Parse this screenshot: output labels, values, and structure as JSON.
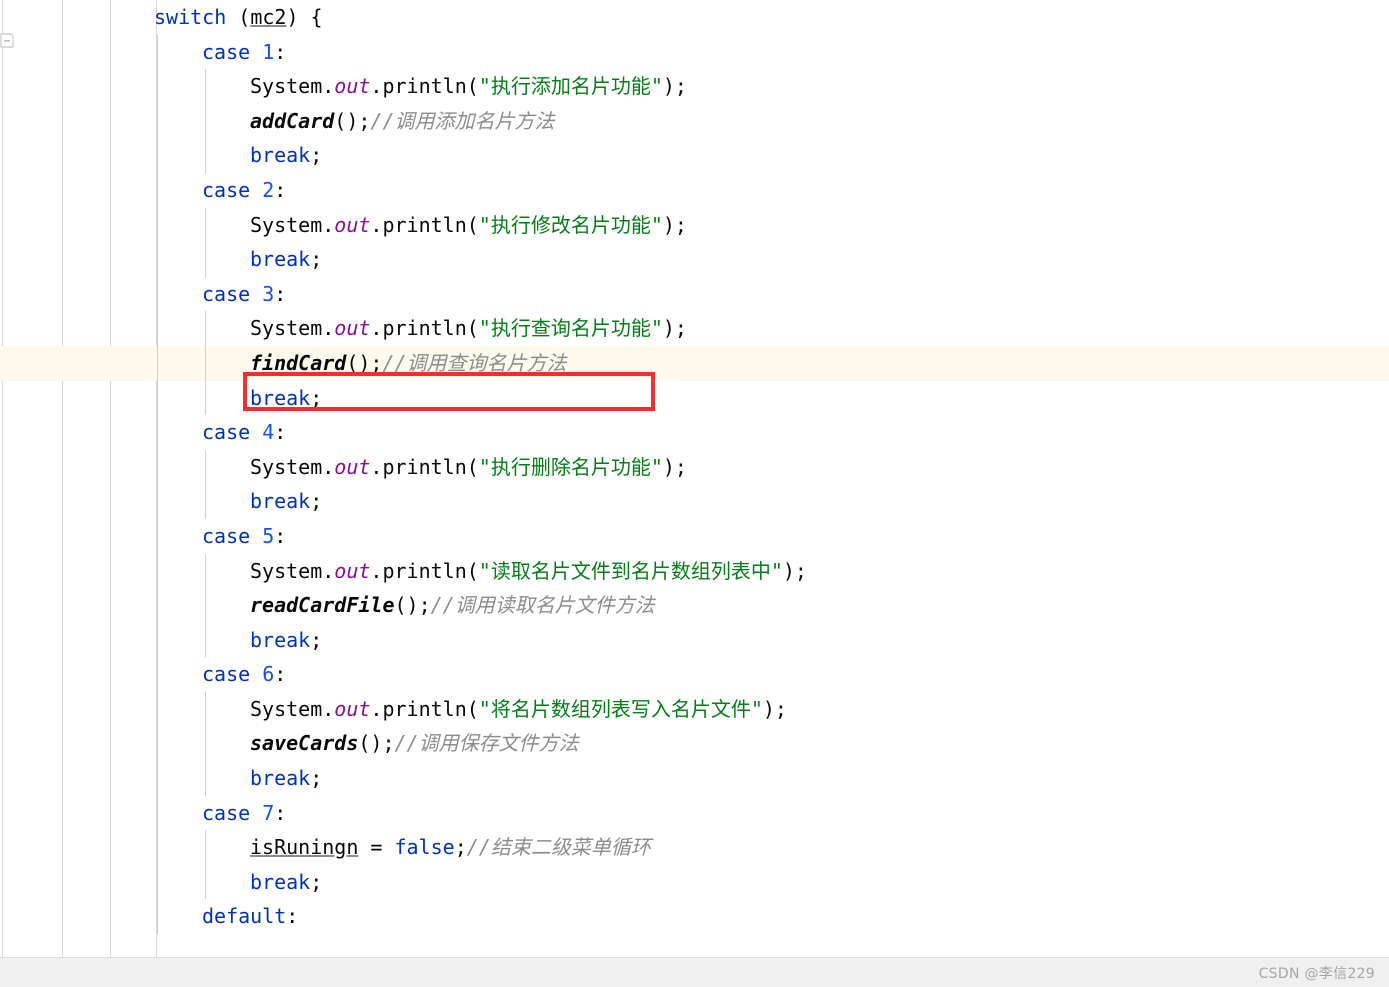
{
  "editor": {
    "gutter": {
      "fold_marker": "fold-collapse-marker"
    },
    "highlight_color": "#fdf9ec",
    "annotation": {
      "type": "red-rectangle",
      "color": "#f03030",
      "targets_line": 12,
      "target_text": "findCard();//调用查询名片方法"
    },
    "colors": {
      "keyword": "#0033b3",
      "number": "#1750eb",
      "string": "#067d17",
      "static_field": "#871094",
      "comment": "#8c8c8c",
      "plain": "#080808",
      "guide": "#d0d0d0"
    },
    "lines": [
      {
        "n": 1,
        "indent": 0,
        "guides": [],
        "tokens": [
          {
            "t": "switch",
            "c": "kw"
          },
          {
            "t": " (",
            "c": "pln"
          },
          {
            "t": "mc2",
            "c": "pln ul"
          },
          {
            "t": ") {",
            "c": "pln"
          }
        ]
      },
      {
        "n": 2,
        "indent": 1,
        "guides": [
          "lv1"
        ],
        "tokens": [
          {
            "t": "case",
            "c": "kw"
          },
          {
            "t": " ",
            "c": "pln"
          },
          {
            "t": "1",
            "c": "num"
          },
          {
            "t": ":",
            "c": "pln"
          }
        ]
      },
      {
        "n": 3,
        "indent": 2,
        "guides": [
          "lv1",
          "lv2"
        ],
        "tokens": [
          {
            "t": "System",
            "c": "pln"
          },
          {
            "t": ".",
            "c": "pln"
          },
          {
            "t": "out",
            "c": "fld"
          },
          {
            "t": ".println(",
            "c": "pln"
          },
          {
            "t": "\"执行添加名片功能\"",
            "c": "str"
          },
          {
            "t": ");",
            "c": "pln"
          }
        ]
      },
      {
        "n": 4,
        "indent": 2,
        "guides": [
          "lv1",
          "lv2"
        ],
        "tokens": [
          {
            "t": "addCard",
            "c": "mth"
          },
          {
            "t": "();",
            "c": "pln"
          },
          {
            "t": "//调用添加名片方法",
            "c": "cmt"
          }
        ]
      },
      {
        "n": 5,
        "indent": 2,
        "guides": [
          "lv1",
          "lv2"
        ],
        "tokens": [
          {
            "t": "break",
            "c": "kw"
          },
          {
            "t": ";",
            "c": "pln"
          }
        ]
      },
      {
        "n": 6,
        "indent": 1,
        "guides": [
          "lv1"
        ],
        "tokens": [
          {
            "t": "case",
            "c": "kw"
          },
          {
            "t": " ",
            "c": "pln"
          },
          {
            "t": "2",
            "c": "num"
          },
          {
            "t": ":",
            "c": "pln"
          }
        ]
      },
      {
        "n": 7,
        "indent": 2,
        "guides": [
          "lv1",
          "lv2"
        ],
        "tokens": [
          {
            "t": "System",
            "c": "pln"
          },
          {
            "t": ".",
            "c": "pln"
          },
          {
            "t": "out",
            "c": "fld"
          },
          {
            "t": ".println(",
            "c": "pln"
          },
          {
            "t": "\"执行修改名片功能\"",
            "c": "str"
          },
          {
            "t": ");",
            "c": "pln"
          }
        ]
      },
      {
        "n": 8,
        "indent": 2,
        "guides": [
          "lv1",
          "lv2"
        ],
        "tokens": [
          {
            "t": "break",
            "c": "kw"
          },
          {
            "t": ";",
            "c": "pln"
          }
        ]
      },
      {
        "n": 9,
        "indent": 1,
        "guides": [
          "lv1"
        ],
        "tokens": [
          {
            "t": "case",
            "c": "kw"
          },
          {
            "t": " ",
            "c": "pln"
          },
          {
            "t": "3",
            "c": "num"
          },
          {
            "t": ":",
            "c": "pln"
          }
        ]
      },
      {
        "n": 10,
        "indent": 2,
        "guides": [
          "lv1",
          "lv2"
        ],
        "tokens": [
          {
            "t": "System",
            "c": "pln"
          },
          {
            "t": ".",
            "c": "pln"
          },
          {
            "t": "out",
            "c": "fld"
          },
          {
            "t": ".println(",
            "c": "pln"
          },
          {
            "t": "\"执行查询名片功能\"",
            "c": "str"
          },
          {
            "t": ");",
            "c": "pln"
          }
        ]
      },
      {
        "n": 11,
        "indent": 2,
        "guides": [
          "lv1",
          "lv2"
        ],
        "highlight": true,
        "tokens": [
          {
            "t": "findCard",
            "c": "mth"
          },
          {
            "t": "();",
            "c": "pln"
          },
          {
            "t": "//调用查询名片方法",
            "c": "cmt"
          }
        ]
      },
      {
        "n": 12,
        "indent": 2,
        "guides": [
          "lv1",
          "lv2"
        ],
        "tokens": [
          {
            "t": "break",
            "c": "kw"
          },
          {
            "t": ";",
            "c": "pln"
          }
        ]
      },
      {
        "n": 13,
        "indent": 1,
        "guides": [
          "lv1"
        ],
        "tokens": [
          {
            "t": "case",
            "c": "kw"
          },
          {
            "t": " ",
            "c": "pln"
          },
          {
            "t": "4",
            "c": "num"
          },
          {
            "t": ":",
            "c": "pln"
          }
        ]
      },
      {
        "n": 14,
        "indent": 2,
        "guides": [
          "lv1",
          "lv2"
        ],
        "tokens": [
          {
            "t": "System",
            "c": "pln"
          },
          {
            "t": ".",
            "c": "pln"
          },
          {
            "t": "out",
            "c": "fld"
          },
          {
            "t": ".println(",
            "c": "pln"
          },
          {
            "t": "\"执行删除名片功能\"",
            "c": "str"
          },
          {
            "t": ");",
            "c": "pln"
          }
        ]
      },
      {
        "n": 15,
        "indent": 2,
        "guides": [
          "lv1",
          "lv2"
        ],
        "tokens": [
          {
            "t": "break",
            "c": "kw"
          },
          {
            "t": ";",
            "c": "pln"
          }
        ]
      },
      {
        "n": 16,
        "indent": 1,
        "guides": [
          "lv1"
        ],
        "tokens": [
          {
            "t": "case",
            "c": "kw"
          },
          {
            "t": " ",
            "c": "pln"
          },
          {
            "t": "5",
            "c": "num"
          },
          {
            "t": ":",
            "c": "pln"
          }
        ]
      },
      {
        "n": 17,
        "indent": 2,
        "guides": [
          "lv1",
          "lv2"
        ],
        "tokens": [
          {
            "t": "System",
            "c": "pln"
          },
          {
            "t": ".",
            "c": "pln"
          },
          {
            "t": "out",
            "c": "fld"
          },
          {
            "t": ".println(",
            "c": "pln"
          },
          {
            "t": "\"读取名片文件到名片数组列表中\"",
            "c": "str"
          },
          {
            "t": ");",
            "c": "pln"
          }
        ]
      },
      {
        "n": 18,
        "indent": 2,
        "guides": [
          "lv1",
          "lv2"
        ],
        "tokens": [
          {
            "t": "readCardFile",
            "c": "mth"
          },
          {
            "t": "();",
            "c": "pln"
          },
          {
            "t": "//调用读取名片文件方法",
            "c": "cmt"
          }
        ]
      },
      {
        "n": 19,
        "indent": 2,
        "guides": [
          "lv1",
          "lv2"
        ],
        "tokens": [
          {
            "t": "break",
            "c": "kw"
          },
          {
            "t": ";",
            "c": "pln"
          }
        ]
      },
      {
        "n": 20,
        "indent": 1,
        "guides": [
          "lv1"
        ],
        "tokens": [
          {
            "t": "case",
            "c": "kw"
          },
          {
            "t": " ",
            "c": "pln"
          },
          {
            "t": "6",
            "c": "num"
          },
          {
            "t": ":",
            "c": "pln"
          }
        ]
      },
      {
        "n": 21,
        "indent": 2,
        "guides": [
          "lv1",
          "lv2"
        ],
        "tokens": [
          {
            "t": "System",
            "c": "pln"
          },
          {
            "t": ".",
            "c": "pln"
          },
          {
            "t": "out",
            "c": "fld"
          },
          {
            "t": ".println(",
            "c": "pln"
          },
          {
            "t": "\"将名片数组列表写入名片文件\"",
            "c": "str"
          },
          {
            "t": ");",
            "c": "pln"
          }
        ]
      },
      {
        "n": 22,
        "indent": 2,
        "guides": [
          "lv1",
          "lv2"
        ],
        "tokens": [
          {
            "t": "saveCards",
            "c": "mth"
          },
          {
            "t": "();",
            "c": "pln"
          },
          {
            "t": "//调用保存文件方法",
            "c": "cmt"
          }
        ]
      },
      {
        "n": 23,
        "indent": 2,
        "guides": [
          "lv1",
          "lv2"
        ],
        "tokens": [
          {
            "t": "break",
            "c": "kw"
          },
          {
            "t": ";",
            "c": "pln"
          }
        ]
      },
      {
        "n": 24,
        "indent": 1,
        "guides": [
          "lv1"
        ],
        "tokens": [
          {
            "t": "case",
            "c": "kw"
          },
          {
            "t": " ",
            "c": "pln"
          },
          {
            "t": "7",
            "c": "num"
          },
          {
            "t": ":",
            "c": "pln"
          }
        ]
      },
      {
        "n": 25,
        "indent": 2,
        "guides": [
          "lv1",
          "lv2"
        ],
        "tokens": [
          {
            "t": "isRuningn",
            "c": "pln ul"
          },
          {
            "t": " = ",
            "c": "pln"
          },
          {
            "t": "false",
            "c": "kw"
          },
          {
            "t": ";",
            "c": "pln"
          },
          {
            "t": "//结束二级菜单循环",
            "c": "cmt"
          }
        ]
      },
      {
        "n": 26,
        "indent": 2,
        "guides": [
          "lv1",
          "lv2"
        ],
        "tokens": [
          {
            "t": "break",
            "c": "kw"
          },
          {
            "t": ";",
            "c": "pln"
          }
        ]
      },
      {
        "n": 27,
        "indent": 1,
        "guides": [
          "lv1"
        ],
        "tokens": [
          {
            "t": "default",
            "c": "kw"
          },
          {
            "t": ":",
            "c": "pln"
          }
        ]
      }
    ]
  },
  "footer": {
    "watermark": "CSDN @李信229"
  }
}
